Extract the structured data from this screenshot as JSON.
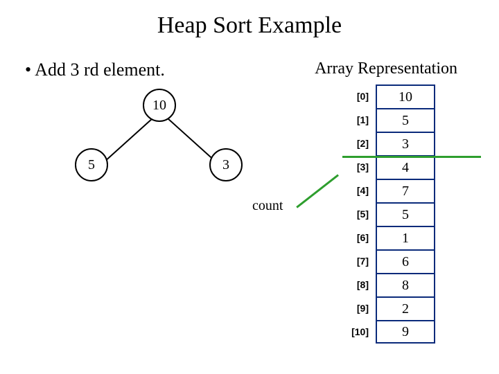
{
  "title": "Heap Sort Example",
  "bullet": "• Add 3 rd element.",
  "array_rep_label": "Array Representation",
  "tree": {
    "root": "10",
    "left": "5",
    "right": "3"
  },
  "count_label": "count",
  "array": [
    {
      "index": "[0]",
      "value": "10"
    },
    {
      "index": "[1]",
      "value": "5"
    },
    {
      "index": "[2]",
      "value": "3"
    },
    {
      "index": "[3]",
      "value": "4"
    },
    {
      "index": "[4]",
      "value": "7"
    },
    {
      "index": "[5]",
      "value": "5"
    },
    {
      "index": "[6]",
      "value": "1"
    },
    {
      "index": "[7]",
      "value": "6"
    },
    {
      "index": "[8]",
      "value": "8"
    },
    {
      "index": "[9]",
      "value": "2"
    },
    {
      "index": "[10]",
      "value": "9"
    }
  ],
  "count_points_to": 3
}
